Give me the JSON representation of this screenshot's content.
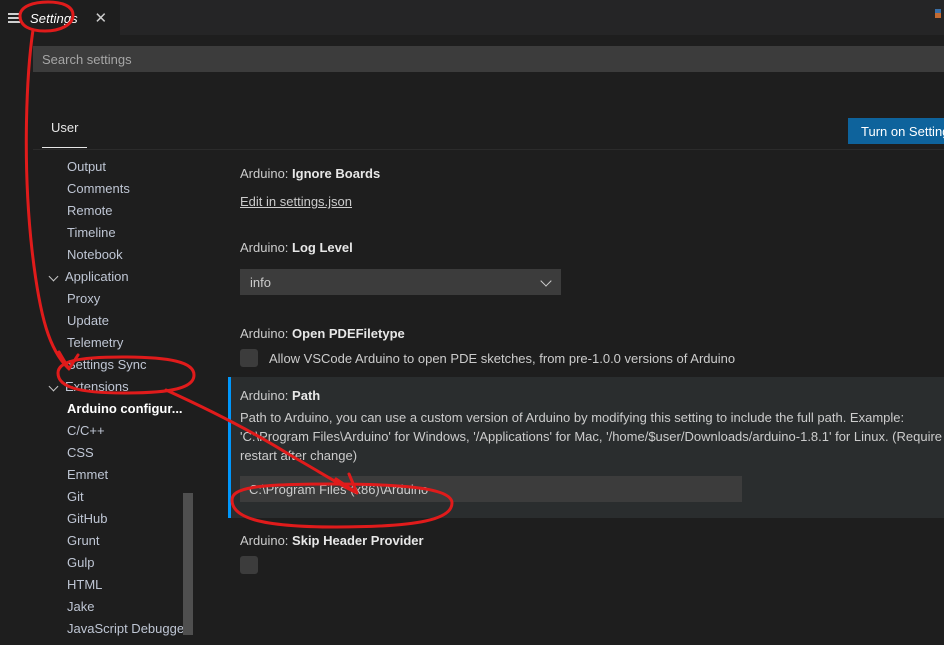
{
  "window": {
    "title": "Settings"
  },
  "tabbar": {
    "menu_icon": "hamburger-icon",
    "tab_label": "Settings",
    "close_icon": "close-icon"
  },
  "search": {
    "placeholder": "Search settings",
    "value": ""
  },
  "scope": {
    "tab_label": "User",
    "sync_button_label": "Turn on Settings Sync"
  },
  "toc": {
    "items": [
      {
        "label": "Output",
        "level": "child",
        "expandable": false,
        "selected": false
      },
      {
        "label": "Comments",
        "level": "child",
        "expandable": false,
        "selected": false
      },
      {
        "label": "Remote",
        "level": "child",
        "expandable": false,
        "selected": false
      },
      {
        "label": "Timeline",
        "level": "child",
        "expandable": false,
        "selected": false
      },
      {
        "label": "Notebook",
        "level": "child",
        "expandable": false,
        "selected": false
      },
      {
        "label": "Application",
        "level": "group",
        "expandable": true,
        "selected": false
      },
      {
        "label": "Proxy",
        "level": "child",
        "expandable": false,
        "selected": false
      },
      {
        "label": "Update",
        "level": "child",
        "expandable": false,
        "selected": false
      },
      {
        "label": "Telemetry",
        "level": "child",
        "expandable": false,
        "selected": false
      },
      {
        "label": "Settings Sync",
        "level": "child",
        "expandable": false,
        "selected": false
      },
      {
        "label": "Extensions",
        "level": "group",
        "expandable": true,
        "selected": false
      },
      {
        "label": "Arduino configur...",
        "level": "child",
        "expandable": false,
        "selected": true
      },
      {
        "label": "C/C++",
        "level": "child",
        "expandable": false,
        "selected": false
      },
      {
        "label": "CSS",
        "level": "child",
        "expandable": false,
        "selected": false
      },
      {
        "label": "Emmet",
        "level": "child",
        "expandable": false,
        "selected": false
      },
      {
        "label": "Git",
        "level": "child",
        "expandable": false,
        "selected": false
      },
      {
        "label": "GitHub",
        "level": "child",
        "expandable": false,
        "selected": false
      },
      {
        "label": "Grunt",
        "level": "child",
        "expandable": false,
        "selected": false
      },
      {
        "label": "Gulp",
        "level": "child",
        "expandable": false,
        "selected": false
      },
      {
        "label": "HTML",
        "level": "child",
        "expandable": false,
        "selected": false
      },
      {
        "label": "Jake",
        "level": "child",
        "expandable": false,
        "selected": false
      },
      {
        "label": "JavaScript Debugger",
        "level": "child",
        "expandable": false,
        "selected": false
      }
    ]
  },
  "settings": {
    "ignore_boards": {
      "prefix": "Arduino: ",
      "name": "Ignore Boards",
      "json_link": "Edit in settings.json"
    },
    "log_level": {
      "prefix": "Arduino: ",
      "name": "Log Level",
      "value": "info",
      "chevron": "chevron-down-icon"
    },
    "open_pde_filetype": {
      "prefix": "Arduino: ",
      "name": "Open PDEFiletype",
      "checkbox_label": "Allow VSCode Arduino to open PDE sketches, from pre-1.0.0 versions of Arduino",
      "checked": false
    },
    "path": {
      "prefix": "Arduino: ",
      "name": "Path",
      "gear_icon": "gear-icon",
      "description_line1": "Path to Arduino, you can use a custom version of Arduino by modifying this setting to include the full path. Example:",
      "description_line2": "'C:\\Program Files\\Arduino' for Windows, '/Applications' for Mac, '/home/$user/Downloads/arduino-1.8.1' for Linux. (Require",
      "description_line3": "restart after change)",
      "value": "C:\\Program Files (x86)\\Arduino",
      "focused": true
    },
    "skip_header_provider": {
      "prefix": "Arduino: ",
      "name": "Skip Header Provider",
      "checked": false
    }
  },
  "colors": {
    "background": "#1e1e1e",
    "tabbar_background": "#252526",
    "input_background": "#3c3c3c",
    "accent_blue": "#0e639c",
    "focus_border": "#0097fb",
    "row_highlight": "#2a2d2e",
    "text": "#cccccc",
    "annotation_red": "#e01b1b"
  }
}
